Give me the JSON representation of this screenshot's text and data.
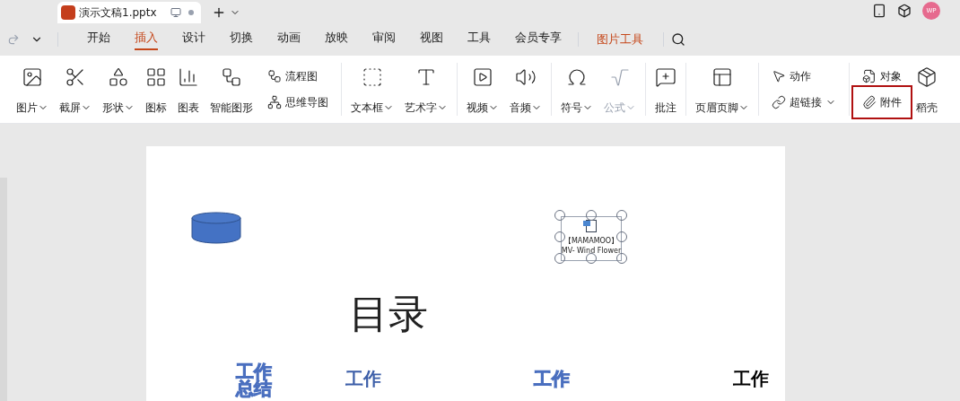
{
  "document_tab": {
    "title": "演示文稿1.pptx"
  },
  "avatar": "WP",
  "menu_tabs": [
    {
      "label": "开始",
      "selected": false
    },
    {
      "label": "插入",
      "selected": true
    },
    {
      "label": "设计",
      "selected": false
    },
    {
      "label": "切换",
      "selected": false
    },
    {
      "label": "动画",
      "selected": false
    },
    {
      "label": "放映",
      "selected": false
    },
    {
      "label": "审阅",
      "selected": false
    },
    {
      "label": "视图",
      "selected": false
    },
    {
      "label": "工具",
      "selected": false
    },
    {
      "label": "会员专享",
      "selected": false
    }
  ],
  "context_tab": {
    "label": "图片工具"
  },
  "ribbon_groups": [
    [
      {
        "kind": "big",
        "label": "图片",
        "dropdown": true
      },
      {
        "kind": "big",
        "label": "截屏",
        "dropdown": true
      },
      {
        "kind": "big",
        "label": "形状",
        "dropdown": true
      },
      {
        "kind": "big",
        "label": "图标"
      },
      {
        "kind": "big",
        "label": "图表"
      },
      {
        "kind": "big",
        "label": "智能图形"
      },
      {
        "kind": "stack",
        "rows": [
          {
            "label": "流程图"
          },
          {
            "label": "思维导图"
          }
        ]
      }
    ],
    [
      {
        "kind": "big",
        "label": "文本框",
        "dropdown": true
      },
      {
        "kind": "big",
        "label": "艺术字",
        "dropdown": true
      }
    ],
    [
      {
        "kind": "big",
        "label": "视频",
        "dropdown": true
      },
      {
        "kind": "big",
        "label": "音频",
        "dropdown": true
      }
    ],
    [
      {
        "kind": "big",
        "label": "符号",
        "dropdown": true
      },
      {
        "kind": "big",
        "label": "公式",
        "dropdown": true,
        "disabled": true
      }
    ],
    [
      {
        "kind": "big",
        "label": "批注"
      }
    ],
    [
      {
        "kind": "big",
        "label": "页眉页脚",
        "dropdown": true
      }
    ],
    [
      {
        "kind": "stack",
        "rows": [
          {
            "label": "动作"
          },
          {
            "label": "超链接",
            "dropdown": true
          }
        ]
      }
    ],
    [
      {
        "kind": "stack",
        "rows": [
          {
            "label": "对象"
          },
          {
            "label": "附件",
            "highlighted": true
          }
        ]
      },
      {
        "kind": "big",
        "label": "稻壳"
      }
    ]
  ],
  "slide": {
    "attachment": {
      "lines": [
        "【MAMAMOO】",
        "MV- Wind Flower"
      ],
      "selected": true
    },
    "title": "目录",
    "wordart": [
      "工作总结",
      "工作",
      "工作",
      "工作"
    ]
  }
}
